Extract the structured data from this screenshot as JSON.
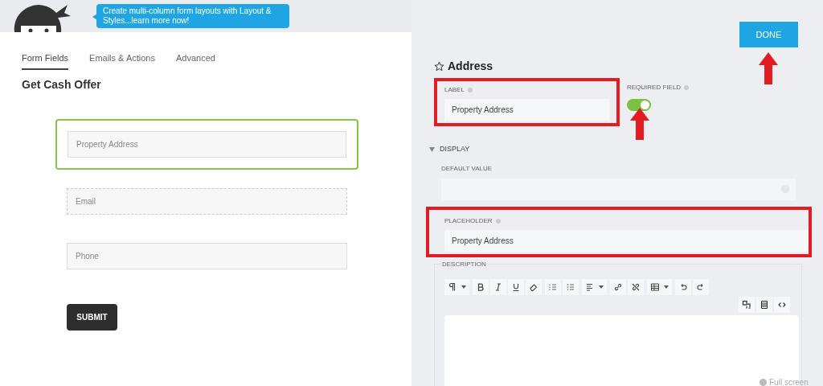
{
  "tooltip": "Create multi-column form layouts with Layout & Styles...learn more now!",
  "tabs": [
    {
      "label": "Form Fields",
      "selected": true
    },
    {
      "label": "Emails & Actions",
      "selected": false
    },
    {
      "label": "Advanced",
      "selected": false
    }
  ],
  "form": {
    "title": "Get Cash Offer",
    "fields": [
      {
        "placeholder": "Property Address",
        "selected": true,
        "dashed": false
      },
      {
        "placeholder": "Email",
        "selected": false,
        "dashed": true
      },
      {
        "placeholder": "Phone",
        "selected": false,
        "dashed": false
      }
    ],
    "submit": "SUBMIT"
  },
  "done_button": {
    "label": "DONE",
    "annotated": true
  },
  "settings": {
    "title": "Address",
    "label": {
      "caption": "LABEL",
      "value": "Property Address",
      "highlighted": true
    },
    "required": {
      "caption": "REQUIRED FIELD",
      "on": true,
      "annotated": true
    },
    "display": {
      "caption": "DISPLAY",
      "expanded": true
    },
    "default_value": {
      "caption": "DEFAULT VALUE"
    },
    "placeholder": {
      "caption": "PLACEHOLDER",
      "value": "Property Address",
      "highlighted": true
    },
    "description": {
      "caption": "DESCRIPTION"
    },
    "full_screen": "Full screen"
  }
}
